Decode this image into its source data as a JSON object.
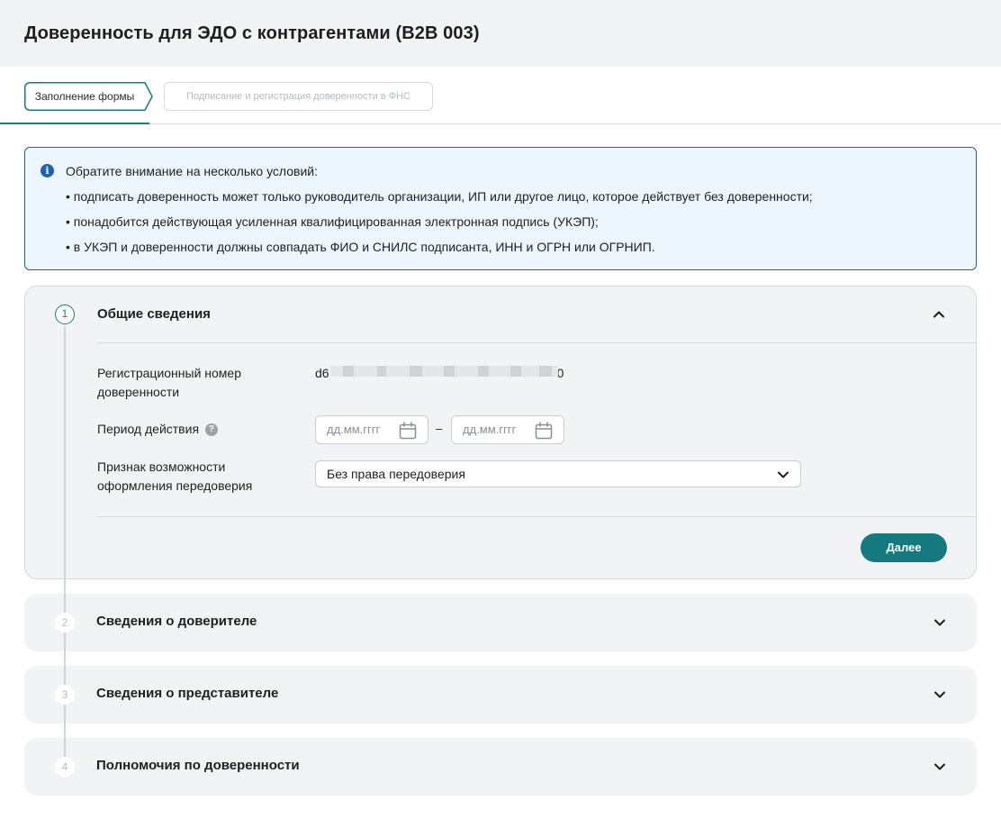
{
  "page": {
    "title": "Доверенность для ЭДО с контрагентами (B2B 003)"
  },
  "steps": [
    {
      "label": "Заполнение формы"
    },
    {
      "label": "Подписание и регистрация доверенности в ФНС"
    }
  ],
  "notice": {
    "title": "Обратите внимание на несколько условий:",
    "items": [
      "• подписать доверенность может только руководитель организации, ИП или другое лицо, которое действует без доверенности;",
      "• понадобится действующая усиленная квалифицированная электронная подпись (УКЭП);",
      "• в УКЭП и доверенности должны совпадать ФИО и СНИЛС подписанта, ИНН и ОГРН или ОГРНИП."
    ]
  },
  "sections": [
    {
      "number": "1",
      "title": "Общие сведения"
    },
    {
      "number": "2",
      "title": "Сведения о доверителе"
    },
    {
      "number": "3",
      "title": "Сведения о представителе"
    },
    {
      "number": "4",
      "title": "Полномочия по доверенности"
    }
  ],
  "general": {
    "reg_number_label_1": "Регистрационный номер",
    "reg_number_label_2": "доверенности",
    "reg_number_start": "d6",
    "reg_number_end": "0",
    "period_label": "Период действия",
    "help_glyph": "?",
    "date_from_placeholder": "дд.мм.гггг",
    "date_to_placeholder": "дд.мм.гггг",
    "date_separator": "–",
    "redelegation_label_1": "Признак возможности",
    "redelegation_label_2": "оформления передоверия",
    "redelegation_value": "Без права передоверия",
    "next_button": "Далее"
  },
  "colors": {
    "accent": "#157a80",
    "info": "#1d61b3",
    "section_bg": "#f2f3f5"
  }
}
